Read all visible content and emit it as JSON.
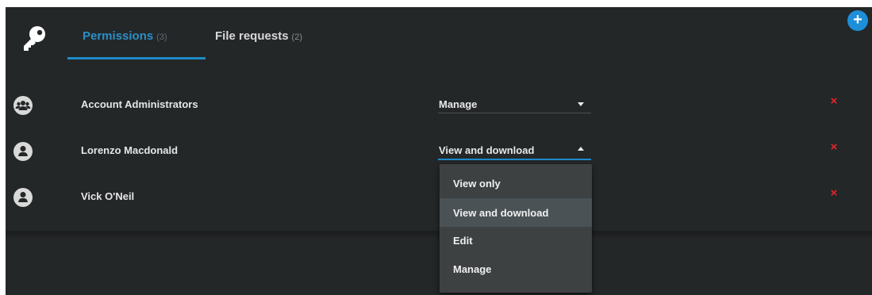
{
  "tabs": [
    {
      "label": "Permissions",
      "count": "(3)"
    },
    {
      "label": "File requests",
      "count": "(2)"
    }
  ],
  "icons": {
    "key": "key-icon",
    "add": "plus-icon",
    "group": "group-icon",
    "user": "user-icon",
    "remove": "close-icon"
  },
  "add_button_glyph": "+",
  "rows": [
    {
      "name": "Account Administrators",
      "permission": "Manage",
      "avatar": "group-icon",
      "remove_glyph": "×"
    },
    {
      "name": "Lorenzo Macdonald",
      "permission": "View and download",
      "avatar": "user-icon",
      "remove_glyph": "×"
    },
    {
      "name": "Vick O'Neil",
      "permission": "",
      "avatar": "user-icon",
      "remove_glyph": "×"
    }
  ],
  "dropdown": {
    "options": [
      "View only",
      "View and download",
      "Edit",
      "Manage"
    ],
    "selected": "View and download"
  },
  "colors": {
    "panel": "#242728",
    "accent": "#1f8bc9",
    "remove": "#e8242a",
    "dropdown_bg": "#3e4142",
    "dropdown_selected": "#4a5256"
  }
}
